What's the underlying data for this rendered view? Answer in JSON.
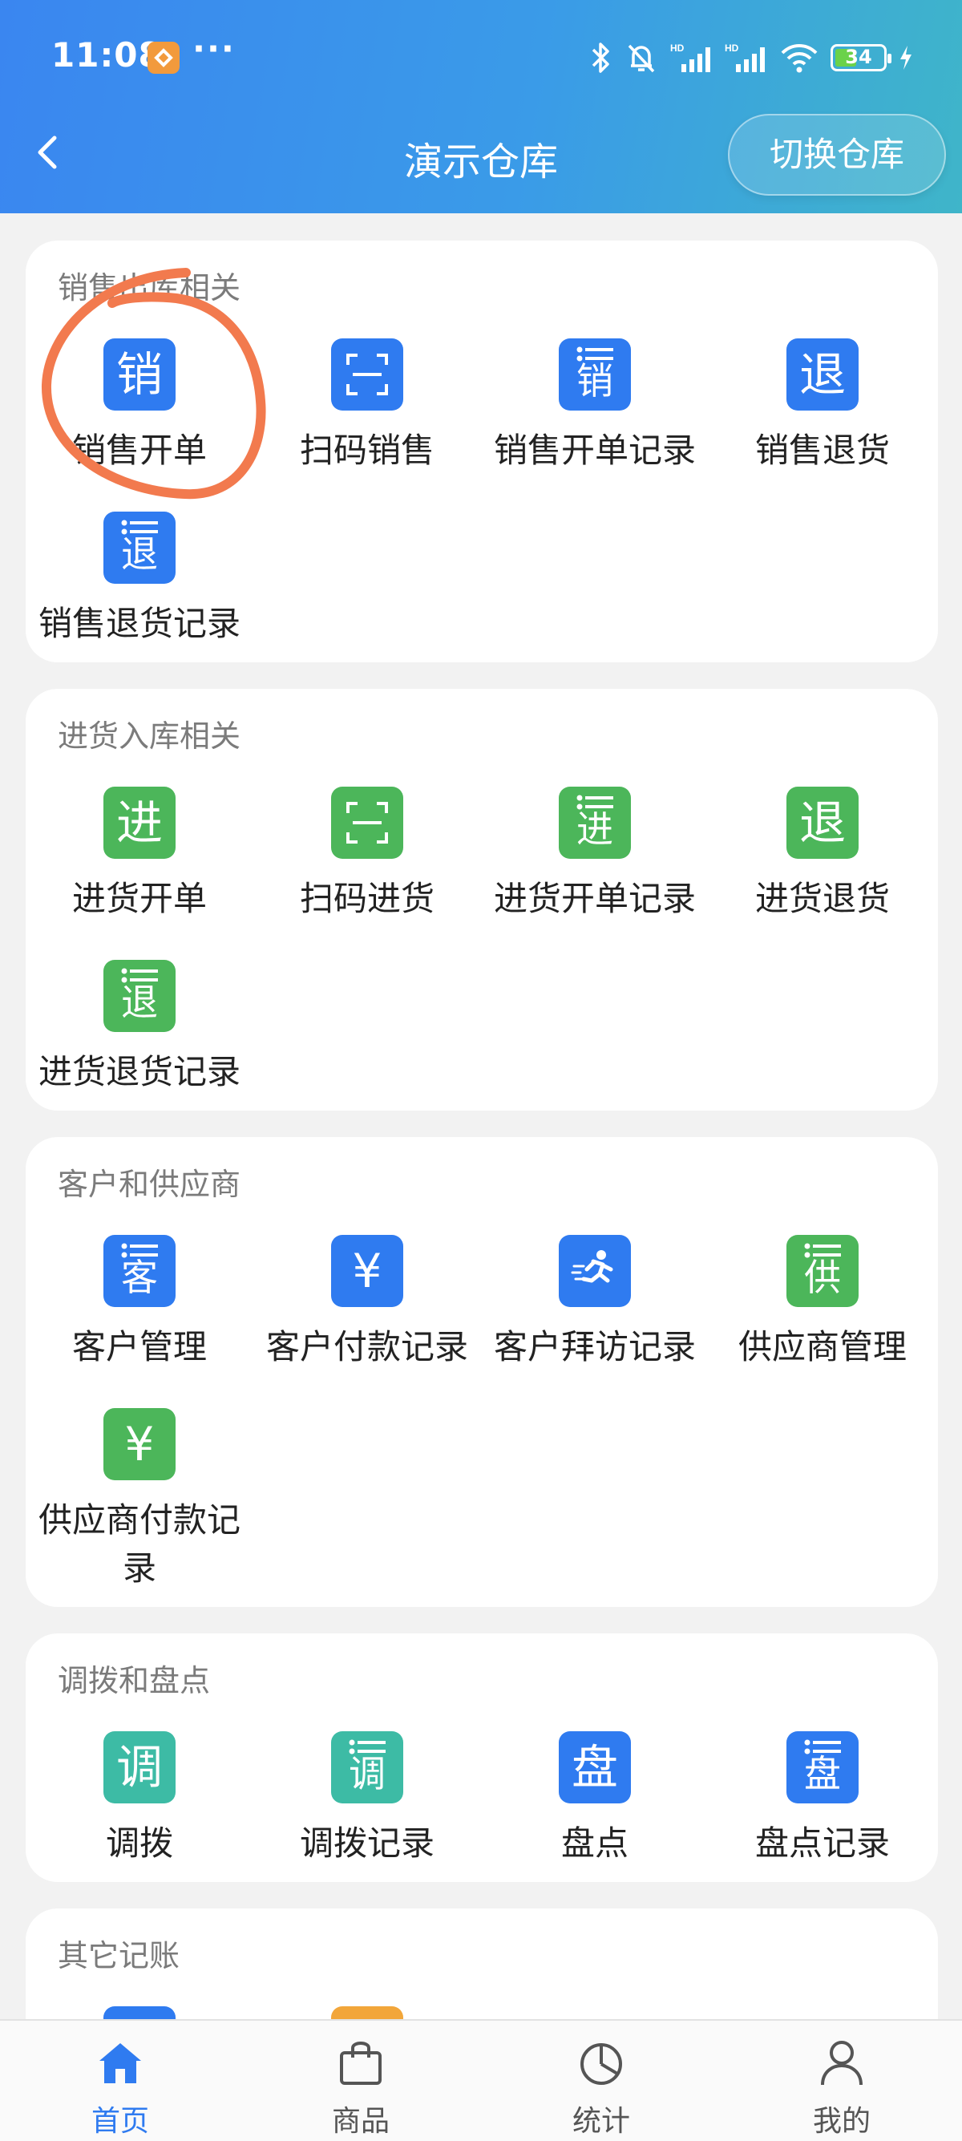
{
  "status_bar": {
    "time": "11:08",
    "dots": "···",
    "battery": "34"
  },
  "header": {
    "title": "演示仓库",
    "switch_label": "切换仓库"
  },
  "sections": [
    {
      "title": "销售出库相关",
      "items": [
        {
          "label": "销售开单",
          "icon": "销",
          "style": "plain",
          "color": "#2f7bf0"
        },
        {
          "label": "扫码销售",
          "icon": "scan-icon",
          "style": "scan",
          "color": "#2f7bf0"
        },
        {
          "label": "销售开单记录",
          "icon": "销",
          "style": "list",
          "color": "#2f7bf0"
        },
        {
          "label": "销售退货",
          "icon": "退",
          "style": "plain",
          "color": "#2f7bf0"
        },
        {
          "label": "销售退货记录",
          "icon": "退",
          "style": "list",
          "color": "#2f7bf0"
        }
      ]
    },
    {
      "title": "进货入库相关",
      "items": [
        {
          "label": "进货开单",
          "icon": "进",
          "style": "plain",
          "color": "#4cb65a"
        },
        {
          "label": "扫码进货",
          "icon": "scan-icon",
          "style": "scan",
          "color": "#4cb65a"
        },
        {
          "label": "进货开单记录",
          "icon": "进",
          "style": "list",
          "color": "#4cb65a"
        },
        {
          "label": "进货退货",
          "icon": "退",
          "style": "plain",
          "color": "#4cb65a"
        },
        {
          "label": "进货退货记录",
          "icon": "退",
          "style": "list",
          "color": "#4cb65a"
        }
      ]
    },
    {
      "title": "客户和供应商",
      "items": [
        {
          "label": "客户管理",
          "icon": "客",
          "style": "list",
          "color": "#2f7bf0"
        },
        {
          "label": "客户付款记录",
          "icon": "¥",
          "style": "plain",
          "color": "#2f7bf0"
        },
        {
          "label": "客户拜访记录",
          "icon": "runner-icon",
          "style": "runner",
          "color": "#2f7bf0"
        },
        {
          "label": "供应商管理",
          "icon": "供",
          "style": "list",
          "color": "#4cb65a"
        },
        {
          "label": "供应商付款记录",
          "icon": "¥",
          "style": "plain",
          "color": "#4cb65a"
        }
      ]
    },
    {
      "title": "调拨和盘点",
      "items": [
        {
          "label": "调拨",
          "icon": "调",
          "style": "plain",
          "color": "#3dbba5"
        },
        {
          "label": "调拨记录",
          "icon": "调",
          "style": "list",
          "color": "#3dbba5"
        },
        {
          "label": "盘点",
          "icon": "盘",
          "style": "plain",
          "color": "#2f7bf0"
        },
        {
          "label": "盘点记录",
          "icon": "盘",
          "style": "list",
          "color": "#2f7bf0"
        }
      ]
    },
    {
      "title": "其它记账",
      "items": []
    }
  ],
  "tabbar": [
    {
      "label": "首页",
      "icon": "home-icon",
      "active": true
    },
    {
      "label": "商品",
      "icon": "bag-icon",
      "active": false
    },
    {
      "label": "统计",
      "icon": "pie-icon",
      "active": false
    },
    {
      "label": "我的",
      "icon": "user-icon",
      "active": false
    }
  ],
  "colors": {
    "accent": "#2f7bf0",
    "green": "#4cb65a",
    "teal": "#3dbba5",
    "annotation": "#f27a4e"
  }
}
